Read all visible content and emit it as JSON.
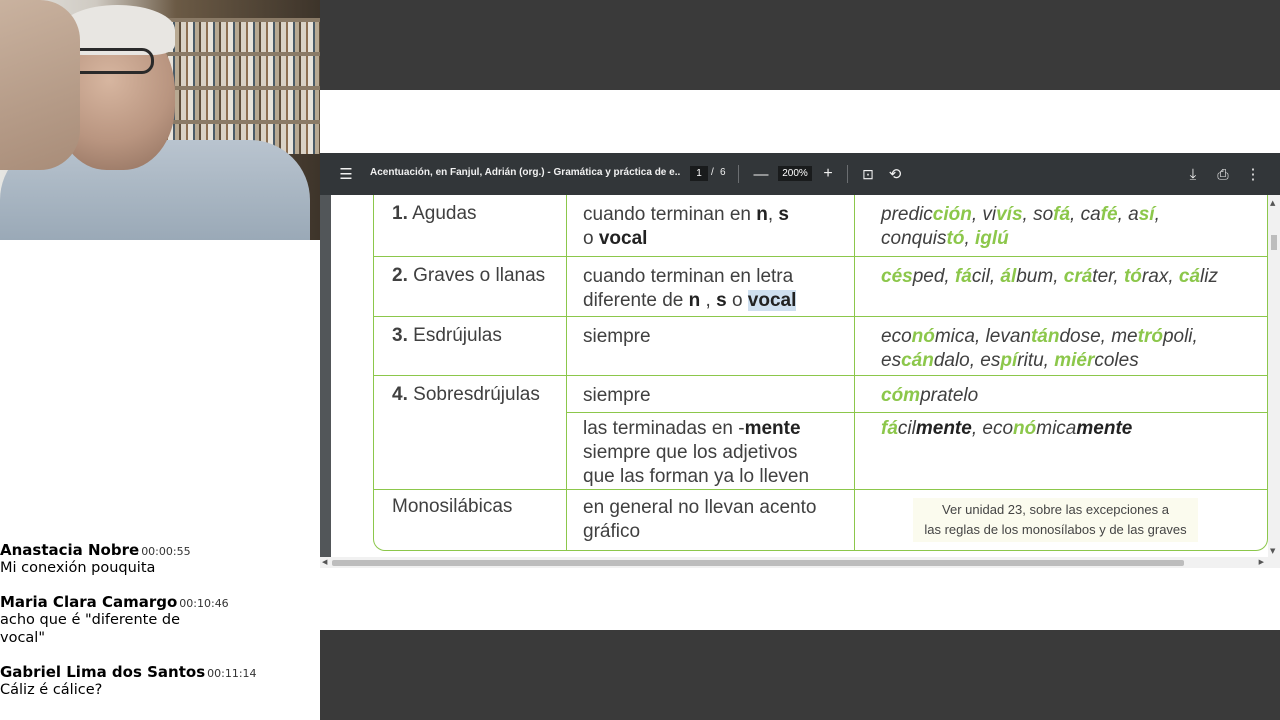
{
  "chat": [
    {
      "author": "Anastacia Nobre",
      "time": "00:00:55",
      "text": "Mi conexión pouquita"
    },
    {
      "author": "Maria Clara Camargo",
      "time": "00:10:46",
      "text": "acho que é \"diferente de\nvocal\""
    },
    {
      "author": "Gabriel Lima dos Santos",
      "time": "00:11:14",
      "text": "Cáliz é cálice?"
    }
  ],
  "viewer": {
    "title": "Acentuación, en Fanjul, Adrián (org.) - Gramática y práctica de e...",
    "page_current": "1",
    "page_sep": "/",
    "page_total": "6",
    "zoom": "200%",
    "icons": {
      "menu": "☰",
      "zoom_out": "—",
      "zoom_in": "+",
      "fit": "⊡",
      "rotate": "⟲",
      "download": "⤓",
      "print": "⎙",
      "more": "⋮"
    }
  },
  "table": {
    "rows": [
      {
        "num": "1.",
        "label": "Agudas"
      },
      {
        "num": "2.",
        "label": "Graves o llanas"
      },
      {
        "num": "3.",
        "label": "Esdrújulas"
      },
      {
        "num": "4.",
        "label": "Sobresdrújulas"
      },
      {
        "num": "",
        "label": "Monosilábicas"
      }
    ],
    "r1c2a": "cuando terminan en ",
    "r1c2b": "n",
    "r1c2c": ", ",
    "r1c2d": "s",
    "r1c2e": "o ",
    "r1c2f": "vocal",
    "r2c2a": "cuando terminan en letra",
    "r2c2b": "diferente de ",
    "r2c2c": "n",
    "r2c2d": " , ",
    "r2c2e": "s",
    "r2c2f": " o ",
    "r2c2g": "vocal",
    "r3c2": "siempre",
    "r4c2a": "siempre",
    "r4c2b": "las terminadas en -",
    "r4c2c": "mente",
    "r4c2d": "siempre que los adjetivos",
    "r4c2e": "que las forman ya lo lleven",
    "r5c2a": "en general no llevan acento",
    "r5c2b": "gráfico",
    "note1": "Ver unidad 23, sobre las excepciones a",
    "note2": "las reglas de los monosílabos y de las graves",
    "ex": {
      "predic": "predic",
      "cion": "ción",
      "comma1": ", vi",
      "vis": "vís",
      "comma2": ", so",
      "fa": "fá",
      "comma3": ", ca",
      "fe": "fé",
      "comma4": ", a",
      "si": "sí",
      "comma5": ",",
      "conquis": "conquis",
      "to": "tó",
      "comma6": ", ",
      "iglu_g": "iglú",
      "ces": "cés",
      "ped": "ped, ",
      "fa2": "fá",
      "cil": "cil, ",
      "al": "ál",
      "bum": "bum, ",
      "cra": "crá",
      "ter": "ter, ",
      "to2": "tó",
      "rax": "rax, ",
      "ca": "cá",
      "liz": "liz",
      "eco": "eco",
      "no": "nó",
      "mica": "mica, levan",
      "tan": "tán",
      "dose": "dose, me",
      "tro": "tró",
      "poli": "poli,",
      "es": "es",
      "can": "cán",
      "dalo": "dalo, es",
      "pi": "pí",
      "ritu": "ritu, ",
      "mier": "miér",
      "coles": "coles",
      "com": "cóm",
      "pratelo": "pratelo",
      "fa3": "fá",
      "cil2": "cil",
      "mente1": "mente",
      "eco2": ", eco",
      "no2": "nó",
      "mica2": "mica",
      "mente2": "mente"
    }
  }
}
